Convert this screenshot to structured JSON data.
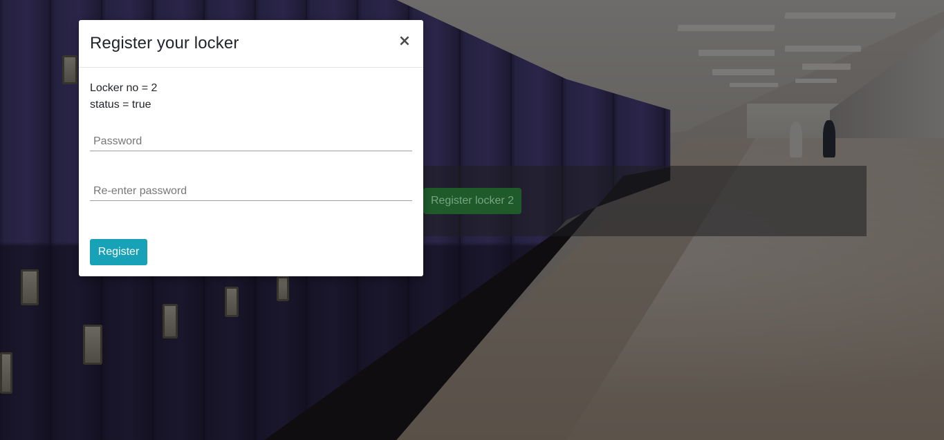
{
  "background": {
    "secondary_button_label": "Register locker 2"
  },
  "modal": {
    "title": "Register your locker",
    "close_label": "×",
    "locker_line": "Locker no = 2",
    "status_line": "status = true",
    "password_placeholder": "Password",
    "reenter_placeholder": "Re-enter password",
    "register_label": "Register"
  },
  "colors": {
    "primary_button": "#17a2b8",
    "background_button": "#1e5a2a"
  }
}
